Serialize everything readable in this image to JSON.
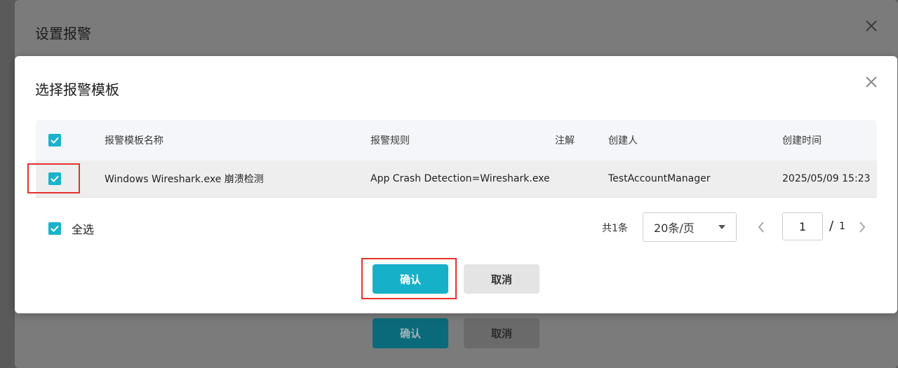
{
  "outer_dialog": {
    "title": "设置报警",
    "close_icon": "close-icon",
    "confirm_label": "确认",
    "cancel_label": "取消"
  },
  "dialog": {
    "title": "选择报警模板",
    "close_icon": "close-icon",
    "table": {
      "columns": [
        "报警模板名称",
        "报警规则",
        "注解",
        "创建人",
        "创建时间"
      ],
      "header_checked": true,
      "rows": [
        {
          "checked": true,
          "name": "Windows Wireshark.exe 崩溃检测",
          "rule": "App Crash Detection=Wireshark.exe",
          "note": "",
          "creator": "TestAccountManager",
          "created_at": "2025/05/09 15:23"
        }
      ]
    },
    "select_all_label": "全选",
    "select_all_checked": true,
    "pagination": {
      "total_text": "共1条",
      "page_size": "20条/页",
      "current_page": "1",
      "separator": "/",
      "total_pages": "1"
    },
    "confirm_label": "确认",
    "cancel_label": "取消"
  },
  "colors": {
    "accent": "#17b0c9",
    "highlight": "#e8312b"
  }
}
